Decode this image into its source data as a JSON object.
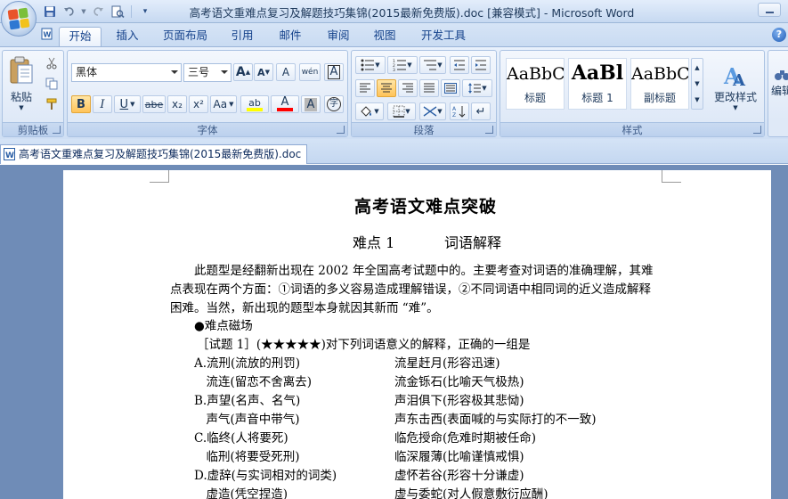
{
  "window": {
    "title": "高考语文重难点复习及解题技巧集锦(2015最新免费版).doc [兼容模式] - Microsoft Word"
  },
  "qat": {
    "save_icon": "save-icon",
    "undo_icon": "undo-icon",
    "redo_icon": "redo-icon",
    "print_preview_icon": "print-preview-icon",
    "customize_icon": "customize-qat-icon"
  },
  "ribbon_tabs": [
    "开始",
    "插入",
    "页面布局",
    "引用",
    "邮件",
    "审阅",
    "视图",
    "开发工具"
  ],
  "clipboard": {
    "paste_label": "粘贴",
    "group_label": "剪贴板"
  },
  "font": {
    "font_name": "黑体",
    "font_size": "三号",
    "grow_label": "A",
    "shrink_label": "A",
    "clear_format_label": "A",
    "phonetic_label": "wén",
    "border_char_label": "A",
    "bold": "B",
    "italic": "I",
    "underline": "U",
    "strike": "abe",
    "subscript": "x₂",
    "superscript": "x²",
    "change_case": "Aa",
    "highlight": "ab",
    "font_color": "A",
    "char_shading": "A",
    "enclose_char": "字",
    "group_label": "字体"
  },
  "paragraph": {
    "group_label": "段落"
  },
  "styles": {
    "items": [
      {
        "sample": "AaBbC",
        "name": "标题"
      },
      {
        "sample": "AaBl",
        "name": "标题 1"
      },
      {
        "sample": "AaBbC",
        "name": "副标题"
      }
    ],
    "change_styles_label": "更改样式",
    "group_label": "样式",
    "edit_label": "编辑"
  },
  "document_tab": {
    "name": "高考语文重难点复习及解题技巧集锦(2015最新免费版).doc"
  },
  "document": {
    "title": "高考语文难点突破",
    "subtitle_num": "难点 1",
    "subtitle_text": "词语解释",
    "para1_line1": "此题型是经翻新出现在 2002 年全国高考试题中的。主要考查对词语的准确理解，其难",
    "para1_line2": "点表现在两个方面：①词语的多义容易造成理解错误，②不同词语中相同词的近义造成解释",
    "para1_line3": "困难。当然，新出现的题型本身就因其新而 “难”。",
    "bullet": "●难点磁场",
    "question": "［试题 1］(★★★★★)对下列词语意义的解释，正确的一组是",
    "options": [
      {
        "left": "A.流刑(流放的刑罚)",
        "right": "流星赶月(形容迅速)"
      },
      {
        "left": "　流连(留恋不舍离去)",
        "right": "流金铄石(比喻天气极热)"
      },
      {
        "left": "B.声望(名声、名气)",
        "right": "声泪俱下(形容极其悲恸)"
      },
      {
        "left": "　声气(声音中带气)",
        "right": "声东击西(表面喊的与实际打的不一致)"
      },
      {
        "left": "C.临终(人将要死)",
        "right": "临危授命(危难时期被任命)"
      },
      {
        "left": "　临刑(将要受死刑)",
        "right": "临深履薄(比喻谨慎戒惧)"
      },
      {
        "left": "D.虚辞(与实词相对的词类)",
        "right": "虚怀若谷(形容十分谦虚)"
      },
      {
        "left": "　虚造(凭空捏造)",
        "right": "虚与委蛇(对人假意敷衍应酬)"
      }
    ]
  },
  "colors": {
    "ribbon_bg": "#dbe7f7",
    "tab_text": "#15428b",
    "doc_bg": "#6f8cb7",
    "active_button": "#ffc35a"
  }
}
